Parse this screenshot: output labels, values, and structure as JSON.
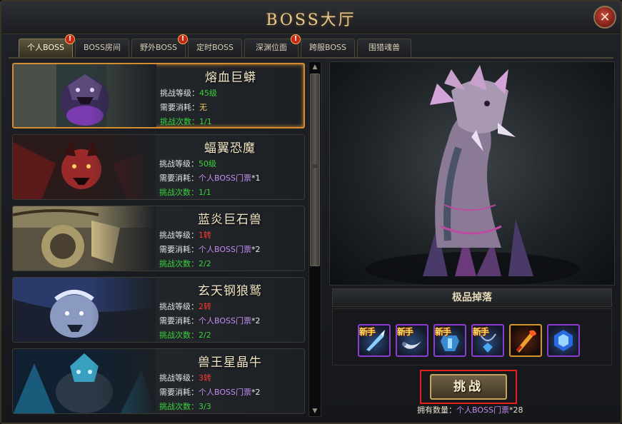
{
  "window": {
    "title": "BOSS大厅",
    "close_glyph": "✕"
  },
  "tabs": [
    {
      "label": "个人BOSS",
      "active": true,
      "alert": "!"
    },
    {
      "label": "BOSS房间",
      "active": false,
      "alert": ""
    },
    {
      "label": "野外BOSS",
      "active": false,
      "alert": "!"
    },
    {
      "label": "定时BOSS",
      "active": false,
      "alert": ""
    },
    {
      "label": "深渊位面",
      "active": false,
      "alert": "!"
    },
    {
      "label": "跨服BOSS",
      "active": false,
      "alert": ""
    },
    {
      "label": "围猎魂兽",
      "active": false,
      "alert": ""
    }
  ],
  "bosses": [
    {
      "name": "熔血巨蟒",
      "level_label": "挑战等级：",
      "level": "45级",
      "level_color": "green",
      "cost_label": "需要消耗：",
      "cost": "无",
      "cost_suffix": "",
      "attempts_label": "挑战次数：",
      "attempts": "1/1",
      "selected": true,
      "art_colors": [
        "#5b4a7a",
        "#2d6b3a",
        "#8a3fc2"
      ]
    },
    {
      "name": "蝠翼恐魔",
      "level_label": "挑战等级：",
      "level": "50级",
      "level_color": "green",
      "cost_label": "需要消耗：",
      "cost": "个人BOSS门票",
      "cost_suffix": "*1",
      "attempts_label": "挑战次数：",
      "attempts": "1/1",
      "selected": false,
      "art_colors": [
        "#5a1a1a",
        "#9a2a2a",
        "#2a1a1a"
      ]
    },
    {
      "name": "蓝炎巨石兽",
      "level_label": "挑战等级：",
      "level": "1转",
      "level_color": "red",
      "cost_label": "需要消耗：",
      "cost": "个人BOSS门票",
      "cost_suffix": "*2",
      "attempts_label": "挑战次数：",
      "attempts": "2/2",
      "selected": false,
      "art_colors": [
        "#a89a6a",
        "#4a4030",
        "#c9b884"
      ]
    },
    {
      "name": "玄天钢狼鹫",
      "level_label": "挑战等级：",
      "level": "2转",
      "level_color": "red",
      "cost_label": "需要消耗：",
      "cost": "个人BOSS门票",
      "cost_suffix": "*2",
      "attempts_label": "挑战次数：",
      "attempts": "2/2",
      "selected": false,
      "art_colors": [
        "#2a3a6a",
        "#8a9ac0",
        "#1a2030"
      ]
    },
    {
      "name": "兽王星晶牛",
      "level_label": "挑战等级：",
      "level": "3转",
      "level_color": "red",
      "cost_label": "需要消耗：",
      "cost": "个人BOSS门票",
      "cost_suffix": "*2",
      "attempts_label": "挑战次数：",
      "attempts": "3/3",
      "selected": false,
      "art_colors": [
        "#1a5a7a",
        "#3aa0c0",
        "#102030"
      ]
    }
  ],
  "scrollbar": {
    "up_glyph": "▲",
    "down_glyph": "▼",
    "grip_glyph": "≡"
  },
  "drops": {
    "header": "极品掉落",
    "items": [
      {
        "icon": "ice-sword-icon",
        "tag": "新手",
        "frame": "purple"
      },
      {
        "icon": "curved-blade-icon",
        "tag": "新手",
        "frame": "purple"
      },
      {
        "icon": "crystal-armor-icon",
        "tag": "新手",
        "frame": "purple"
      },
      {
        "icon": "crystal-necklace-icon",
        "tag": "新手",
        "frame": "purple"
      },
      {
        "icon": "flame-sword-icon",
        "tag": "",
        "frame": "gold"
      },
      {
        "icon": "blue-gem-icon",
        "tag": "",
        "frame": "purple"
      }
    ]
  },
  "challenge": {
    "button_label": "挑战",
    "owned_label": "拥有数量：",
    "owned_item": "个人BOSS门票",
    "owned_count": "*28"
  },
  "colors": {
    "accent": "#d58c2e",
    "highlight": "#e0221b",
    "title": "#e7c98e",
    "green": "#39d33a",
    "red": "#ff3b2f",
    "purple": "#c58cf0"
  }
}
